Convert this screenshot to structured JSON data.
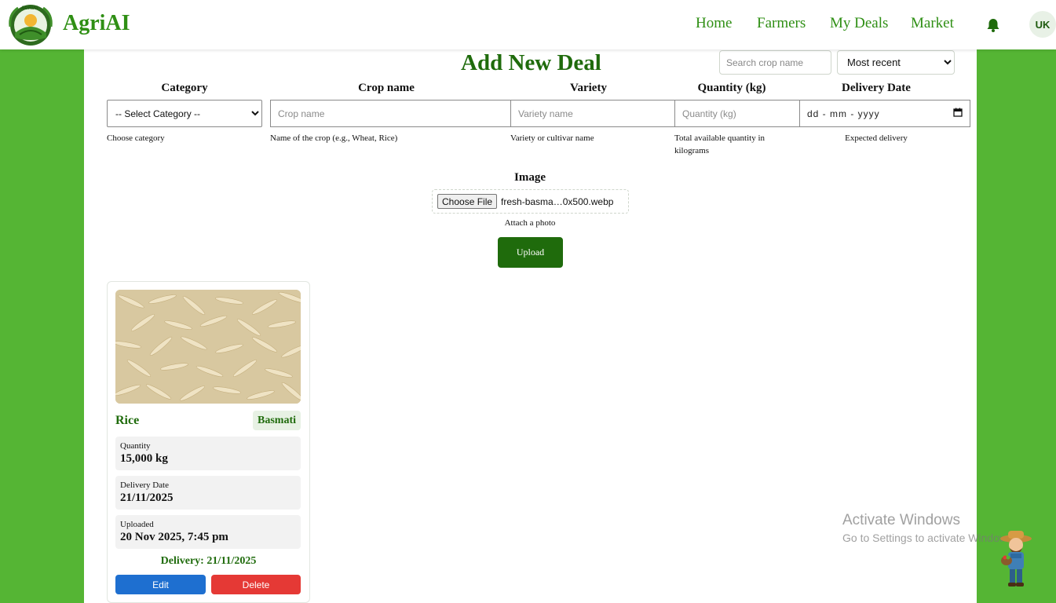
{
  "header": {
    "brand": "AgriAI",
    "logo_text": "AGRIAI",
    "nav": [
      {
        "label": "Home"
      },
      {
        "label": "Farmers"
      },
      {
        "label": "My Deals"
      },
      {
        "label": "Market"
      }
    ],
    "avatar_initials": "UK",
    "icons": {
      "bell": "bell-icon"
    }
  },
  "page": {
    "title": "Add New Deal",
    "search_placeholder": "Search crop name",
    "sort_selected": "Most recent"
  },
  "form": {
    "category": {
      "label": "Category",
      "selected": "-- Select Category --",
      "hint": "Choose category"
    },
    "crop_name": {
      "label": "Crop name",
      "placeholder": "Crop name",
      "hint": "Name of the crop (e.g., Wheat, Rice)"
    },
    "variety": {
      "label": "Variety",
      "placeholder": "Variety name",
      "hint": "Variety or cultivar name"
    },
    "quantity": {
      "label": "Quantity (kg)",
      "placeholder": "Quantity (kg)",
      "hint": "Total available quantity in kilograms"
    },
    "delivery_date": {
      "label": "Delivery Date",
      "value": "dd - mm - yyyy",
      "hint": "Expected delivery"
    },
    "image": {
      "label": "Image",
      "button": "Choose File",
      "filename": "fresh-basma…0x500.webp",
      "hint": "Attach a photo"
    },
    "upload_label": "Upload"
  },
  "deal_card": {
    "crop": "Rice",
    "variety": "Basmati",
    "quantity_label": "Quantity",
    "quantity_value": "15,000 kg",
    "delivery_label": "Delivery Date",
    "delivery_value": "21/11/2025",
    "uploaded_label": "Uploaded",
    "uploaded_value": "20 Nov 2025, 7:45 pm",
    "delivery_line": "Delivery: 21/11/2025",
    "edit_label": "Edit",
    "delete_label": "Delete"
  },
  "watermark": {
    "title": "Activate Windows",
    "subtitle": "Go to Settings to activate Windows."
  },
  "colors": {
    "brand_green": "#2f8f14",
    "dark_green": "#1f6b0c",
    "background_green": "#55b534",
    "edit_blue": "#1e6fd0",
    "delete_red": "#e53935"
  }
}
